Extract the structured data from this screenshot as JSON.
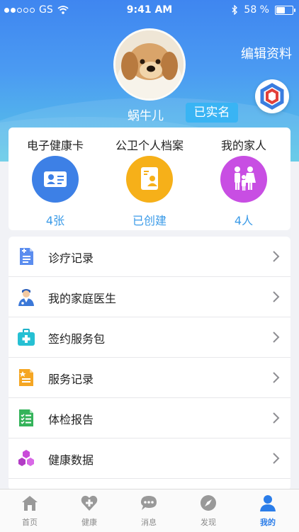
{
  "status_bar": {
    "carrier": "GS",
    "time": "9:41 AM",
    "battery": "58 %",
    "battery_level": 0.58
  },
  "header": {
    "edit_label": "编辑资料",
    "user_name": "蜗牛儿",
    "verified_label": "已实名"
  },
  "cards": [
    {
      "title": "电子健康卡",
      "count": "4张",
      "icon": "id-card-icon",
      "color": "#3d80e6"
    },
    {
      "title": "公卫个人档案",
      "count": "已创建",
      "icon": "profile-document-icon",
      "color": "#f6b019"
    },
    {
      "title": "我的家人",
      "count": "4人",
      "icon": "family-icon",
      "color": "#c84ee3"
    }
  ],
  "menu": [
    {
      "label": "诊疗记录",
      "icon": "medical-record-icon"
    },
    {
      "label": "我的家庭医生",
      "icon": "doctor-icon"
    },
    {
      "label": "签约服务包",
      "icon": "medical-kit-icon"
    },
    {
      "label": "服务记录",
      "icon": "service-record-icon"
    },
    {
      "label": "体检报告",
      "icon": "checklist-icon"
    },
    {
      "label": "健康数据",
      "icon": "health-data-icon"
    }
  ],
  "tabs": [
    {
      "label": "首页",
      "icon": "home-icon"
    },
    {
      "label": "健康",
      "icon": "health-heart-icon"
    },
    {
      "label": "消息",
      "icon": "message-icon"
    },
    {
      "label": "发现",
      "icon": "compass-icon"
    },
    {
      "label": "我的",
      "icon": "user-icon",
      "active": true
    }
  ]
}
